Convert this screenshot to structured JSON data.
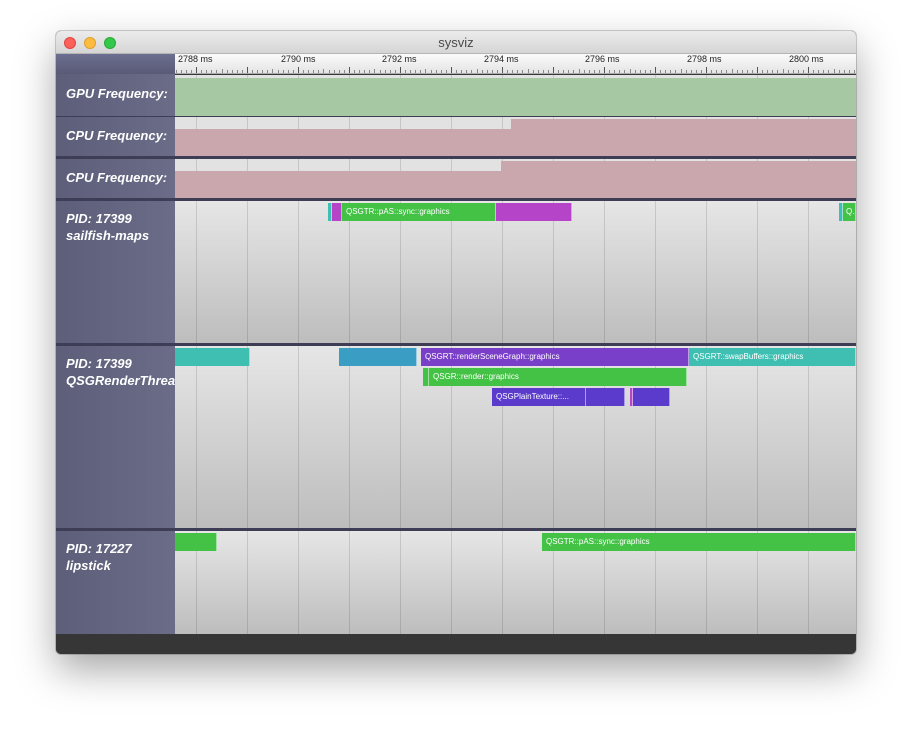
{
  "window": {
    "title": "sysviz"
  },
  "ruler": {
    "ticks": [
      "2788 ms",
      "2790 ms",
      "2792 ms",
      "2794 ms",
      "2796 ms",
      "2798 ms",
      "2800 ms"
    ]
  },
  "tracks": {
    "gpu_freq": {
      "label": "GPU Frequency:"
    },
    "cpu_freq_1": {
      "label": "CPU Frequency:"
    },
    "cpu_freq_2": {
      "label": "CPU Frequency:"
    },
    "proc_maps": {
      "line1": "PID: 17399",
      "line2": "sailfish-maps"
    },
    "proc_render": {
      "line1": "PID: 17399",
      "line2": "QSGRenderThread"
    },
    "proc_lipstick": {
      "line1": "PID: 17227",
      "line2": "lipstick"
    }
  },
  "slices": {
    "maps_sync": "QSGTR::pAS::sync::graphics",
    "maps_sync_2": "QS",
    "render_scene": "QSGRT::renderSceneGraph::graphics",
    "render_swap": "QSGRT::swapBuffers::graphics",
    "render_render": "QSGR::render::graphics",
    "render_plaintex": "QSGPlainTexture::...",
    "lipstick_sync": "QSGTR::pAS::sync::graphics"
  },
  "colors": {
    "gpu_freq": "#a6c9a3",
    "cpu_freq": "#c9a7ac",
    "green": "#43c245",
    "magenta": "#b544c9",
    "purple": "#7a3fc9",
    "indigo": "#5a3bcc",
    "teal": "#3ebfb2",
    "blue": "#3a9dc4"
  }
}
